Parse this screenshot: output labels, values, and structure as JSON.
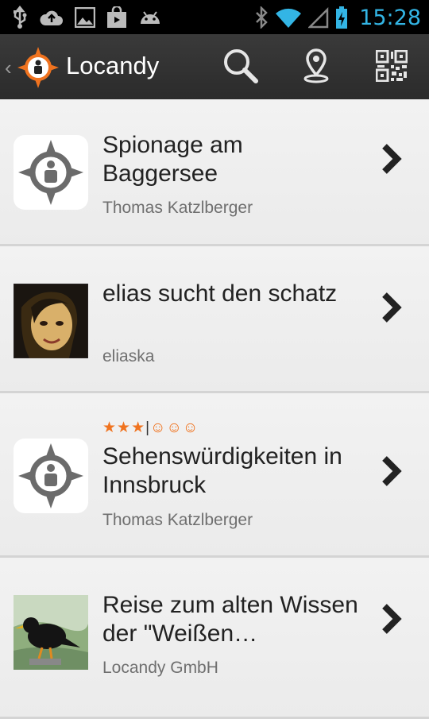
{
  "status_bar": {
    "time": "15:28",
    "icons": [
      "usb-icon",
      "upload-icon",
      "image-icon",
      "store-icon",
      "android-icon",
      "bluetooth-icon",
      "wifi-icon",
      "signal-icon",
      "battery-icon"
    ],
    "time_color": "#33b5e5"
  },
  "action_bar": {
    "title": "Locandy",
    "actions": [
      "search-icon",
      "location-pin-icon",
      "qr-code-icon"
    ],
    "accent": "#f0731f"
  },
  "items": [
    {
      "title": "Spionage am Baggersee",
      "author": "Thomas Katzlberger",
      "rating": "",
      "thumbnail": "compass-placeholder"
    },
    {
      "title": "elias sucht den schatz",
      "author": "eliaska",
      "rating": "",
      "thumbnail": "user-photo"
    },
    {
      "title": "Sehenswürdigkeiten in Innsbruck",
      "author": "Thomas Katzlberger",
      "rating_stars": "★★★",
      "rating_sep": "|",
      "rating_smileys": "☺☺☺",
      "thumbnail": "compass-placeholder"
    },
    {
      "title": "Reise zum alten Wissen der \"Weißen…",
      "author": "Locandy GmbH",
      "rating": "",
      "thumbnail": "bird-painting"
    }
  ]
}
